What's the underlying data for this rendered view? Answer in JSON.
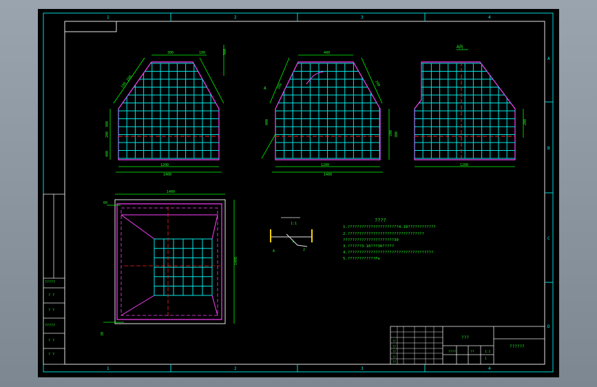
{
  "sheet": {
    "top_zones": [
      "1",
      "2",
      "3",
      "4"
    ],
    "bottom_zones": [
      "1",
      "2",
      "3",
      "4"
    ],
    "right_zones": [
      "A",
      "B",
      "C",
      "D"
    ]
  },
  "front_view": {
    "top_dim": "300",
    "top_dim_right": "100",
    "slope_dims": [
      "100",
      "200"
    ],
    "height_dims": [
      "200",
      "300",
      "400"
    ],
    "bottom_dim": "1200",
    "overall_dim": "1400",
    "right_dim": "500"
  },
  "side_view": {
    "top_dim": "400",
    "slope_dims": [
      "100",
      "200"
    ],
    "height_dims": [
      "200",
      "300",
      "400"
    ],
    "bottom_dim": "1200",
    "overall_dim": "1400",
    "leader_label": "A"
  },
  "aux_view": {
    "label": "A向",
    "right_dim": "200",
    "bottom_dim": "1200"
  },
  "plan_view": {
    "top_dim": "1400",
    "side_dim": "1400",
    "left_dim": "60",
    "corner_dim": "30"
  },
  "detail": {
    "label_top": "1:1",
    "label_mid": "1",
    "label_left": "A",
    "label_right": "2"
  },
  "notes": {
    "title": "????",
    "lines": [
      "1.??????????????????????4.18????????????",
      "2.?????????????????????????????????",
      "  ??????????????????????30",
      "3.??????3-10???30?????",
      "4.?????????????????????????????????????",
      "5.????????????Fe"
    ]
  },
  "left_table": {
    "rows": [
      "?????",
      "? ?",
      "? ?",
      "?????",
      "? ?",
      "? ?"
    ]
  },
  "title_block": {
    "material": "???",
    "drawing_name": "??????",
    "scale_label": "????",
    "scale_value": "1:1",
    "sheet_label": "??",
    "sheet_value": "1",
    "rows": [
      "??",
      "??",
      "??",
      "??",
      "??"
    ]
  }
}
